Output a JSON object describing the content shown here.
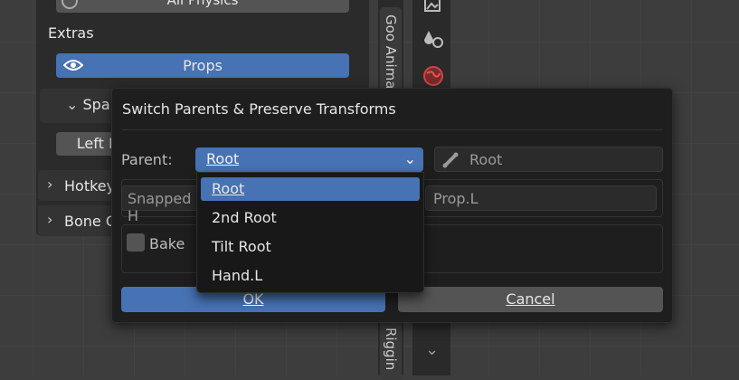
{
  "npanel": {
    "all_physics_label": "All Physics",
    "extras_heading": "Extras",
    "props_label": "Props",
    "space_label_partial": "Spa",
    "left_button_partial": "Left F",
    "hotkeys_partial": "Hotkey",
    "bone_partial": "Bone C"
  },
  "tabs": {
    "top_label": "Goo Anima",
    "bottom_label": "o Riggin"
  },
  "dialog": {
    "title": "Switch Parents & Preserve Transforms",
    "parent_label": "Parent:",
    "parent_value": "Root",
    "target_field_value": "Root",
    "snapped_label_partial": "Snapped H",
    "prop_field_value": "Prop.L",
    "bake_label": "Bake",
    "ok_label": "OK",
    "cancel_label": "Cancel",
    "options": [
      {
        "label": "Root",
        "selected": true
      },
      {
        "label": "2nd Root",
        "selected": false
      },
      {
        "label": "Tilt Root",
        "selected": false
      },
      {
        "label": "Hand.L",
        "selected": false
      }
    ]
  },
  "colors": {
    "accent": "#4772b3",
    "dialog_bg": "#1e1e1e",
    "button_bg": "#545454"
  }
}
